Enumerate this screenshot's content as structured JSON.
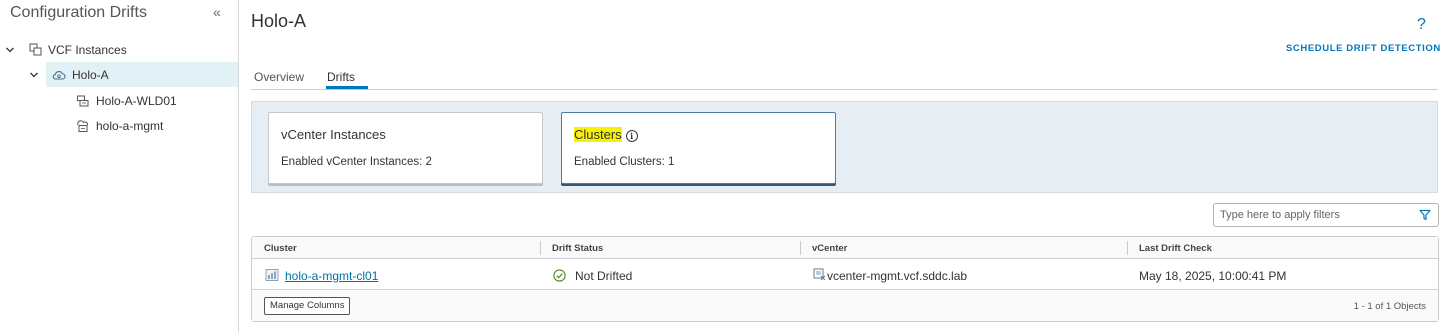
{
  "sidebar": {
    "title": "Configuration Drifts",
    "collapse_glyph": "«",
    "tree": [
      {
        "label": "VCF Instances",
        "icon": "vcf-instances-icon"
      },
      {
        "label": "Holo-A",
        "icon": "cloud-instance-icon"
      },
      {
        "label": "Holo-A-WLD01",
        "icon": "workload-domain-icon"
      },
      {
        "label": "holo-a-mgmt",
        "icon": "management-domain-icon"
      }
    ]
  },
  "header": {
    "title": "Holo-A",
    "help_glyph": "?",
    "schedule_label": "SCHEDULE DRIFT DETECTION"
  },
  "tabs": [
    {
      "label": "Overview"
    },
    {
      "label": "Drifts"
    }
  ],
  "cards": [
    {
      "title": "vCenter Instances",
      "subtitle": "Enabled vCenter Instances: 2"
    },
    {
      "title": "Clusters",
      "info_glyph": "i",
      "subtitle": "Enabled Clusters: 1"
    }
  ],
  "filter": {
    "placeholder": "Type here to apply filters"
  },
  "grid": {
    "columns": [
      "Cluster",
      "Drift Status",
      "vCenter",
      "Last Drift Check"
    ],
    "rows": [
      {
        "cluster": "holo-a-mgmt-cl01",
        "drift_status": "Not Drifted",
        "vcenter": "vcenter-mgmt.vcf.sddc.lab",
        "last_drift_check": "May 18, 2025, 10:00:41 PM"
      }
    ],
    "manage_columns_label": "Manage Columns",
    "pagination": "1 - 1 of 1 Objects"
  },
  "colors": {
    "accent": "#0079b8",
    "link": "#0072a3",
    "selected_bg": "#e1f1f6",
    "highlight": "#f7f200",
    "status_ok": "#4a8a2c"
  }
}
